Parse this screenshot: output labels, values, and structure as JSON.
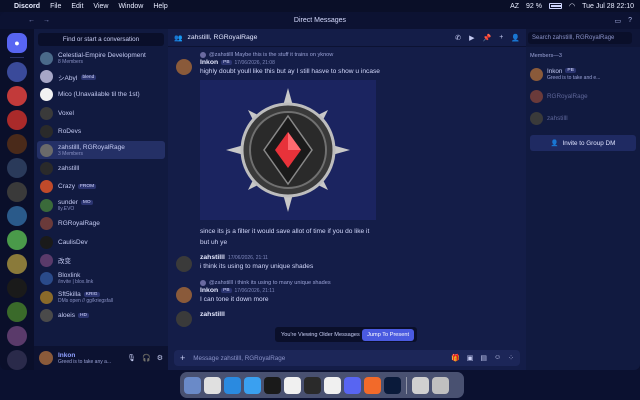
{
  "menubar": {
    "app": "Discord",
    "items": [
      "File",
      "Edit",
      "View",
      "Window",
      "Help"
    ],
    "battery": "92 %",
    "input": "AZ",
    "datetime": "Tue Jul 28  22:10"
  },
  "window": {
    "title": "Direct Messages"
  },
  "sidebar": {
    "find_label": "Find or start a conversation",
    "dms": [
      {
        "name": "Celestial-Empire Development",
        "sub": "8 Members",
        "color": "#4a6a8a"
      },
      {
        "name": "シAbyI",
        "tag": "blend",
        "sub": "",
        "color": "#a7a7c7"
      },
      {
        "name": "Mico (Unavailable til the 1st)",
        "sub": "",
        "color": "#f2f2f2"
      },
      {
        "name": "Voxel",
        "sub": "",
        "color": "#3a3a3a"
      },
      {
        "name": "RoDevs",
        "sub": "",
        "color": "#2a2a2a"
      },
      {
        "name": "zahstilll, RGRoyalRage",
        "sub": "3 Members",
        "color": "#6a6a6a",
        "active": true
      },
      {
        "name": "zahstilll",
        "sub": "",
        "color": "#2a2a2a"
      },
      {
        "name": "Crazy",
        "tag": "FROM",
        "sub": "",
        "color": "#c04a2a"
      },
      {
        "name": "sunder",
        "tag": "MO",
        "sub": "lly.EVO",
        "color": "#3a6a3a"
      },
      {
        "name": "RGRoyalRage",
        "sub": "",
        "color": "#6a3a3a"
      },
      {
        "name": "CaulisDev",
        "sub": "",
        "color": "#1a1a1a"
      },
      {
        "name": "改变",
        "sub": "",
        "color": "#5a3a6a"
      },
      {
        "name": "Bloxlink",
        "sub": "/invite | blox.link",
        "color": "#2a4a8a"
      },
      {
        "name": "Sft5killa",
        "tag": "KRIG",
        "sub": "DMs open // gg/kriegsfall",
        "color": "#8a6a2a"
      },
      {
        "name": "aloeis",
        "tag": "HD",
        "sub": "",
        "color": "#4a4a4a"
      }
    ],
    "user": {
      "name": "Inkon",
      "status": "Greed is to take any a..."
    }
  },
  "chat": {
    "header": "zahstilll, RGRoyalRage",
    "search_placeholder": "Search zahstilll, RGRoyalRage",
    "messages": [
      {
        "reply": "@zahstilll Maybe this is the stuff it trains on yknow",
        "author": "Inkon",
        "tag": "PB",
        "time": "17/06/2026, 21:08",
        "lines": [
          "highly doubt youll like this but ay I still hasve to show u incase"
        ]
      },
      {
        "lines": [
          "since its js a filter it would save allot of time if you do like it",
          "but uh ye"
        ]
      },
      {
        "author": "zahstilll",
        "time": "17/06/2026, 21:11",
        "lines": [
          "i think its using to many unique shades"
        ]
      },
      {
        "reply": "@zahstilll i think its using to many unique shades",
        "author": "Inkon",
        "tag": "PB",
        "time": "17/06/2026, 21:11",
        "lines": [
          "I can tone it down more"
        ]
      },
      {
        "author": "zahstilll",
        "time": "",
        "lines": []
      }
    ],
    "jump": {
      "text": "You're Viewing Older Messages",
      "button": "Jump To Present"
    },
    "composer_placeholder": "Message zahstilll, RGRoyalRage"
  },
  "members": {
    "header": "Members—3",
    "list": [
      {
        "name": "Inkon",
        "tag": "PB",
        "sub": "Greed is to take and e...",
        "color": "#8a5a3a"
      },
      {
        "name": "RGRoyalRage",
        "sub": "",
        "color": "#6a3a3a",
        "dim": true
      },
      {
        "name": "zahstilll",
        "sub": "",
        "color": "#3a3a3a",
        "dim": true
      }
    ],
    "invite_label": "Invite to Group DM"
  },
  "icons": {
    "home": "discord-icon",
    "call": "phone-icon",
    "video": "video-icon",
    "pin": "pin-icon",
    "add_friend": "add-friend-icon",
    "members": "members-icon",
    "plus": "plus-icon",
    "gift": "gift-icon",
    "gif": "gif-icon",
    "sticker": "sticker-icon",
    "emoji": "emoji-icon"
  }
}
